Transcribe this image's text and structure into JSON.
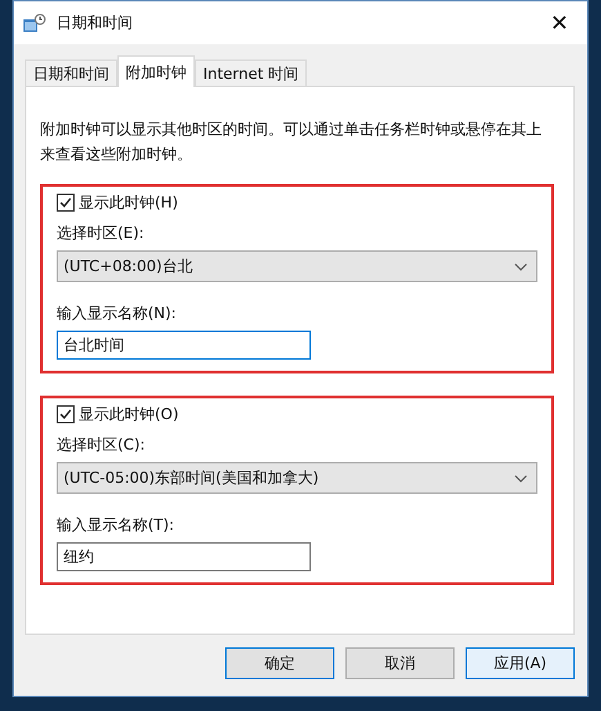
{
  "window": {
    "title": "日期和时间",
    "close": "✕"
  },
  "tabs": [
    {
      "label": "日期和时间",
      "selected": false
    },
    {
      "label": "附加时钟",
      "selected": true
    },
    {
      "label": "Internet 时间",
      "selected": false
    }
  ],
  "description": "附加时钟可以显示其他时区的时间。可以通过单击任务栏时钟或悬停在其上来查看这些附加时钟。",
  "clocks": [
    {
      "show_label": "显示此时钟(H)",
      "checked": true,
      "timezone_label": "选择时区(E):",
      "timezone": "(UTC+08:00)台北",
      "name_label": "输入显示名称(N):",
      "name": "台北时间",
      "focused": true,
      "highlighted": true
    },
    {
      "show_label": "显示此时钟(O)",
      "checked": true,
      "timezone_label": "选择时区(C):",
      "timezone": "(UTC-05:00)东部时间(美国和加拿大)",
      "name_label": "输入显示名称(T):",
      "name": "纽约",
      "focused": false,
      "highlighted": true
    }
  ],
  "buttons": [
    {
      "label": "确定",
      "focused": true,
      "hovered": false
    },
    {
      "label": "取消",
      "focused": false,
      "hovered": false
    },
    {
      "label": "应用(A)",
      "focused": false,
      "hovered": true
    }
  ]
}
